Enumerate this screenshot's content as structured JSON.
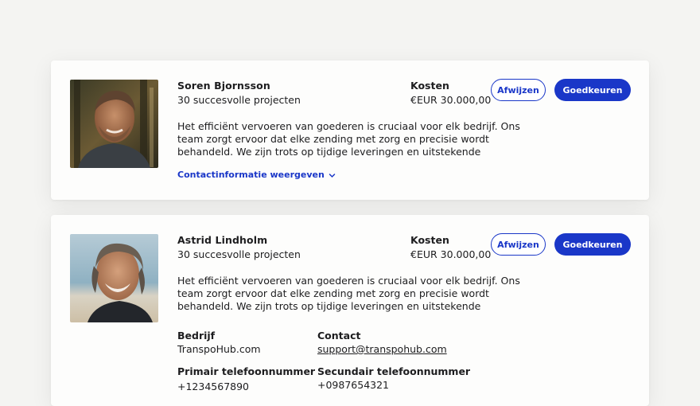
{
  "cards": [
    {
      "name": "Soren Bjornsson",
      "projects": "30 succesvolle projecten",
      "cost_label": "Kosten",
      "cost_value": "€EUR 30.000,00",
      "reject_label": "Afwijzen",
      "approve_label": "Goedkeuren",
      "description": "Het efficiënt vervoeren van goederen is cruciaal voor elk bedrijf. Ons team zorgt ervoor dat elke zending met zorg en precisie wordt behandeld. We zijn trots op tijdige leveringen en uitstekende klantenservice. Van kleine p…",
      "contact_toggle": "Contactinformatie weergeven",
      "toggle_icon": "chevron-down-icon"
    },
    {
      "name": "Astrid Lindholm",
      "projects": "30 succesvolle projecten",
      "cost_label": "Kosten",
      "cost_value": "€EUR 30.000,00",
      "reject_label": "Afwijzen",
      "approve_label": "Goedkeuren",
      "description": "Het efficiënt vervoeren van goederen is cruciaal voor elk bedrijf. Ons team zorgt ervoor dat elke zending met zorg en precisie wordt behandeld. We zijn trots op tijdige leveringen en uitstekende klantenservice. Van kleine p…",
      "contact": {
        "company_label": "Bedrijf",
        "company_value": "TranspoHub.com",
        "contact_label": "Contact",
        "contact_value": "support@transpohub.com",
        "primary_phone_label": "Primair telefoonnummer",
        "primary_phone_value": "+1234567890",
        "secondary_phone_label": "Secundair telefoonnummer",
        "secondary_phone_value": "+0987654321"
      }
    }
  ],
  "colors": {
    "accent": "#1a37c8",
    "background": "#f4f4f2",
    "card": "#fdfdfc",
    "text": "#1d1d1f"
  }
}
